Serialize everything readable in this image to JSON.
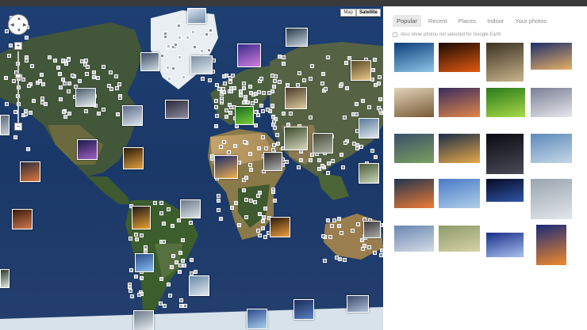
{
  "map": {
    "type_buttons": [
      "Map",
      "Satellite"
    ],
    "active_type": "Satellite",
    "zoom_in": "+",
    "zoom_out": "−",
    "nav_arrows": [
      "▲",
      "▼",
      "◀",
      "▶"
    ]
  },
  "panel": {
    "tabs": [
      "Popular",
      "Recent",
      "Places",
      "Indoor",
      "Your photos"
    ],
    "active_tab": "Popular",
    "option_label": "Also show photos not selected for Google Earth"
  },
  "photos": [
    {
      "name": "ice-cave",
      "c1": "#0d3f7a",
      "c2": "#8fc4e8"
    },
    {
      "name": "orange-sun",
      "c1": "#1a0a04",
      "c2": "#e25a10"
    },
    {
      "name": "forest-road",
      "c1": "#3b3222",
      "c2": "#c8b38a"
    },
    {
      "name": "desert-camels",
      "c1": "#1b2f6b",
      "c2": "#e9b066"
    },
    {
      "name": "lone-tree",
      "c1": "#e2d4ba",
      "c2": "#7a5a35"
    },
    {
      "name": "purple-sunset",
      "c1": "#3a2a5e",
      "c2": "#e0884a"
    },
    {
      "name": "green-field",
      "c1": "#2a7a1a",
      "c2": "#a8d94a"
    },
    {
      "name": "dunes",
      "c1": "#7a7f95",
      "c2": "#e6e6ec"
    },
    {
      "name": "green-valley",
      "c1": "#39506a",
      "c2": "#7aa060"
    },
    {
      "name": "lake-reflection",
      "c1": "#1b2e4a",
      "c2": "#e6a84a"
    },
    {
      "name": "night-figures",
      "c1": "#0a0b12",
      "c2": "#4a4a58"
    },
    {
      "name": "church-village",
      "c1": "#5d8ab8",
      "c2": "#c5d7e8"
    },
    {
      "name": "storm-sunset",
      "c1": "#1f3550",
      "c2": "#f07a35"
    },
    {
      "name": "horse-statue",
      "c1": "#4a7ac8",
      "c2": "#b0cfe8"
    },
    {
      "name": "night-temple",
      "c1": "#060a22",
      "c2": "#3055a8"
    },
    {
      "name": "misty-mountain",
      "c1": "#9aa5b0",
      "c2": "#e2e6ea"
    },
    {
      "name": "calm-water",
      "c1": "#6a86b0",
      "c2": "#d4dce8"
    },
    {
      "name": "misty-hills",
      "c1": "#8c9a6a",
      "c2": "#d8d2a8"
    },
    {
      "name": "blue-light",
      "c1": "#1a2e88",
      "c2": "#a8c0f0"
    },
    {
      "name": "tree-sunset",
      "c1": "#1a2a7a",
      "c2": "#f08a2a"
    }
  ],
  "map_markers": [
    {
      "name": "marker-greenland",
      "c1": "#d8e4ee",
      "c2": "#6f8aa8"
    },
    {
      "name": "marker-canada-west",
      "c1": "#3a4a60",
      "c2": "#d0dce8"
    },
    {
      "name": "marker-canada",
      "c1": "#7a8ca0",
      "c2": "#e4ecf2"
    },
    {
      "name": "marker-iceland",
      "c1": "#2a3a4a",
      "c2": "#c8d4de"
    },
    {
      "name": "marker-scandinavia",
      "c1": "#3a2a8a",
      "c2": "#d080e0"
    },
    {
      "name": "marker-russia",
      "c1": "#5a4a2a",
      "c2": "#e8c888"
    },
    {
      "name": "marker-alaska",
      "c1": "#4a5a6a",
      "c2": "#e8eef2"
    },
    {
      "name": "marker-usa-west",
      "c1": "#5a6a8a",
      "c2": "#dde4ea"
    },
    {
      "name": "marker-europe",
      "c1": "#1a6a1a",
      "c2": "#7ad040"
    },
    {
      "name": "marker-uk",
      "c1": "#4a3a2a",
      "c2": "#e0cca0"
    },
    {
      "name": "marker-usa",
      "c1": "#1a1a4a",
      "c2": "#a060c0"
    },
    {
      "name": "marker-usa-south",
      "c1": "#2a1a0a",
      "c2": "#e0a040"
    },
    {
      "name": "marker-pacific",
      "c1": "#2a2a3a",
      "c2": "#e07a3a"
    },
    {
      "name": "marker-west-edge",
      "c1": "#5a6a7a",
      "c2": "#c8d0d8"
    },
    {
      "name": "marker-north-africa",
      "c1": "#1a2a6a",
      "c2": "#f0b050"
    },
    {
      "name": "marker-middle-east",
      "c1": "#2a2a2a",
      "c2": "#b0b0b0"
    },
    {
      "name": "marker-asia",
      "c1": "#4a4a3a",
      "c2": "#a8b0a0"
    },
    {
      "name": "marker-china",
      "c1": "#5a7a9a",
      "c2": "#e0e8ee"
    },
    {
      "name": "marker-japan",
      "c1": "#4a5a3a",
      "c2": "#c8d8b8"
    },
    {
      "name": "marker-south-america",
      "c1": "#1a1a1a",
      "c2": "#e8a030"
    },
    {
      "name": "marker-brazil",
      "c1": "#6a7a8a",
      "c2": "#dde2e6"
    },
    {
      "name": "marker-chile",
      "c1": "#2a4a8a",
      "c2": "#8ac0f0"
    },
    {
      "name": "marker-argentina",
      "c1": "#6a8aa8",
      "c2": "#e0e8ef"
    },
    {
      "name": "marker-south-africa",
      "c1": "#2a1a0a",
      "c2": "#f0a040"
    },
    {
      "name": "marker-australia",
      "c1": "#3a3a3a",
      "c2": "#aaaaaa"
    },
    {
      "name": "marker-pacific-south",
      "c1": "#3a1a0a",
      "c2": "#d07a50"
    },
    {
      "name": "marker-antarctica-1",
      "c1": "#6a7a8a",
      "c2": "#e6ecf0"
    },
    {
      "name": "marker-antarctica-2",
      "c1": "#2a4a8a",
      "c2": "#a8d0f0"
    },
    {
      "name": "marker-antarctica-3",
      "c1": "#1a2a5a",
      "c2": "#5a80c0"
    },
    {
      "name": "marker-antarctica-4",
      "c1": "#3a4a6a",
      "c2": "#b0c0d8"
    },
    {
      "name": "marker-indian-ocean",
      "c1": "#2a2a3a",
      "c2": "#8a8a9a"
    },
    {
      "name": "marker-east-asia",
      "c1": "#3a4a2a",
      "c2": "#d8d8c0"
    },
    {
      "name": "marker-west-edge-2",
      "c1": "#2a3a2a",
      "c2": "#e0e6e0"
    }
  ]
}
